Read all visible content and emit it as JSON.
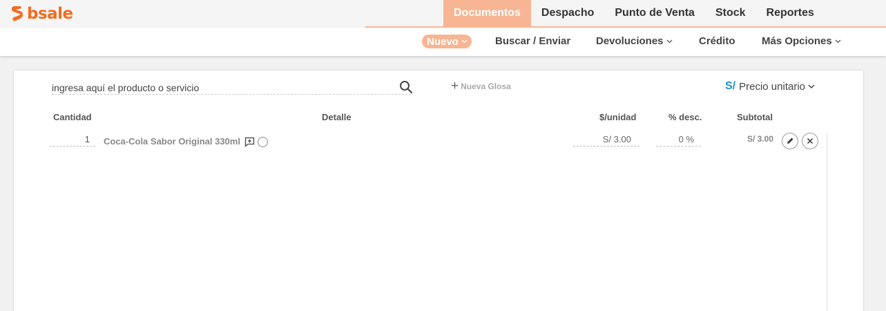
{
  "brand": {
    "name": "bsale",
    "color": "#f26c21"
  },
  "main_nav": [
    {
      "label": "Documentos",
      "active": true
    },
    {
      "label": "Despacho",
      "active": false
    },
    {
      "label": "Punto de Venta",
      "active": false
    },
    {
      "label": "Stock",
      "active": false
    },
    {
      "label": "Reportes",
      "active": false
    }
  ],
  "sub_nav": [
    {
      "label": "Nuevo",
      "active": true,
      "dropdown": true
    },
    {
      "label": "Buscar / Enviar",
      "active": false,
      "dropdown": false
    },
    {
      "label": "Devoluciones",
      "active": false,
      "dropdown": true
    },
    {
      "label": "Crédito",
      "active": false,
      "dropdown": false
    },
    {
      "label": "Más Opciones",
      "active": false,
      "dropdown": true
    }
  ],
  "search": {
    "value": "ingresa aquí el producto o servicio",
    "icon": "search-icon"
  },
  "new_gloss": {
    "label": "Nueva Glosa"
  },
  "price_mode": {
    "currency_symbol": "S/",
    "label": "Precio unitario"
  },
  "table": {
    "headers": {
      "quantity": "Cantidad",
      "detail": "Detalle",
      "unit_price": "$/unidad",
      "discount": "% desc.",
      "subtotal": "Subtotal"
    },
    "rows": [
      {
        "quantity": "1",
        "detail": "Coca-Cola Sabor Original 330ml",
        "unit_price": "S/ 3.00",
        "discount": "0 %",
        "subtotal": "S/ 3.00"
      }
    ]
  },
  "colors": {
    "accent": "#f7b593",
    "currency": "#1a8fc9"
  }
}
